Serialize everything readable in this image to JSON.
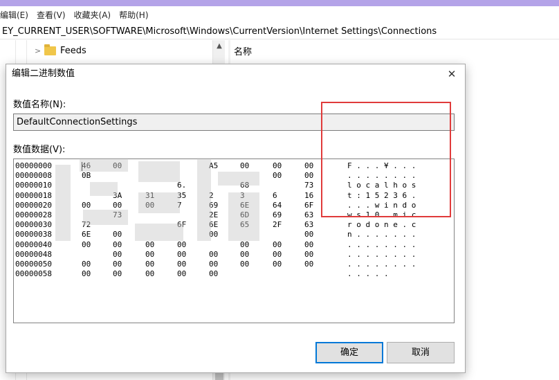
{
  "menu": [
    "编辑(E)",
    "查看(V)",
    "收藏夹(A)",
    "帮助(H)"
  ],
  "address": "EY_CURRENT_USER\\SOFTWARE\\Microsoft\\Windows\\CurrentVersion\\Internet Settings\\Connections",
  "tree": {
    "item": "Feeds"
  },
  "list": {
    "header_name": "名称"
  },
  "dialog": {
    "title": "编辑二进制数值",
    "close": "✕",
    "value_name_label": "数值名称(N):",
    "value_name": "DefaultConnectionSettings",
    "value_data_label": "数值数据(V):",
    "ok": "确定",
    "cancel": "取消"
  },
  "hex_rows": [
    {
      "offset": "00000000",
      "bytes": [
        "46",
        "00",
        "",
        "",
        "A5",
        "00",
        "00",
        "00"
      ],
      "ascii": "F . . . ¥ . . ."
    },
    {
      "offset": "00000008",
      "bytes": [
        "0B",
        "",
        "",
        "",
        "",
        "",
        "00",
        "00"
      ],
      "ascii": ". . . . . . . ."
    },
    {
      "offset": "00000010",
      "bytes": [
        "",
        "",
        "",
        "6.",
        "",
        "68",
        "",
        "73"
      ],
      "ascii": "l o c a l h o s"
    },
    {
      "offset": "00000018",
      "bytes": [
        "",
        "3A",
        "31",
        "35",
        "2",
        "3",
        "6",
        "16"
      ],
      "ascii": "t : 1 5 2 3 6 ."
    },
    {
      "offset": "00000020",
      "bytes": [
        "00",
        "00",
        "00",
        "7",
        "69",
        "6E",
        "64",
        "6F"
      ],
      "ascii": ". . . w i n d o"
    },
    {
      "offset": "00000028",
      "bytes": [
        "",
        "73",
        "",
        "",
        "2E",
        "6D",
        "69",
        "63"
      ],
      "ascii": "w s 1 0 . m i c"
    },
    {
      "offset": "00000030",
      "bytes": [
        "72",
        "",
        "",
        "6F",
        "6E",
        "65",
        "2F",
        "63"
      ],
      "ascii": "r o d o n e . c"
    },
    {
      "offset": "00000038",
      "bytes": [
        "6E",
        "00",
        "",
        "",
        "00",
        "",
        "",
        "00"
      ],
      "ascii": "n . . . . . . ."
    },
    {
      "offset": "00000040",
      "bytes": [
        "00",
        "00",
        "00",
        "00",
        "",
        "00",
        "00",
        "00"
      ],
      "ascii": ". . . . . . . ."
    },
    {
      "offset": "00000048",
      "bytes": [
        "",
        "00",
        "00",
        "00",
        "00",
        "00",
        "00",
        "00"
      ],
      "ascii": ". . . . . . . ."
    },
    {
      "offset": "00000050",
      "bytes": [
        "00",
        "00",
        "00",
        "00",
        "00",
        "00",
        "00",
        "00"
      ],
      "ascii": ". . . . . . . ."
    },
    {
      "offset": "00000058",
      "bytes": [
        "00",
        "00",
        "00",
        "00",
        "00",
        "",
        "",
        ""
      ],
      "ascii": ". . . . ."
    }
  ],
  "colors": {
    "accent_bar": "#b4a3e8",
    "highlight": "#e03a3a",
    "default_button_border": "#0078d7"
  },
  "icons": [
    "chevron-right-icon",
    "folder-icon",
    "scroll-up-icon",
    "close-icon"
  ]
}
